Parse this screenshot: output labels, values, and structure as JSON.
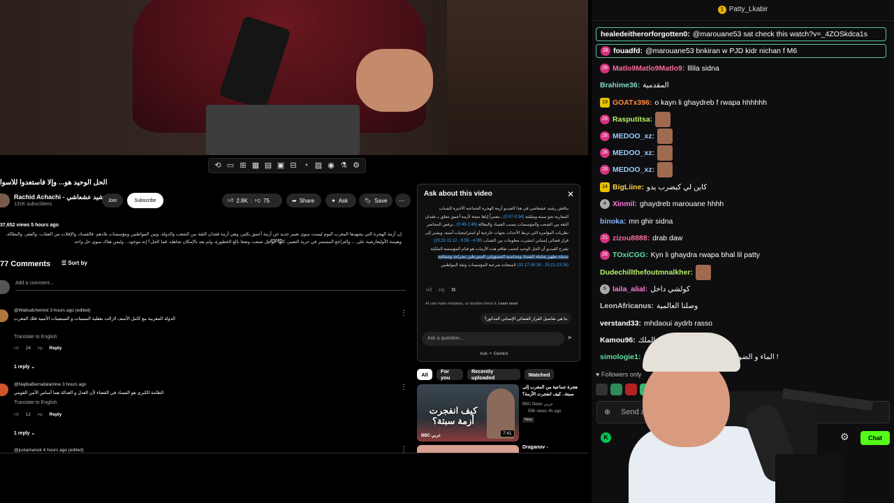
{
  "video": {
    "title": "الحل الوحيد هو... وإلا فاستعدوا للأسوأ"
  },
  "player_controls": [
    "⟲",
    "▭",
    "⊞",
    "▦",
    "▤",
    "▣",
    "⊟",
    "◔",
    "▨",
    "◉",
    "⚗",
    "⚙"
  ],
  "channel": {
    "name": "Rachid Achachi - رشيد عشعاشي",
    "subscribers": "131K subscribers",
    "join_label": "Join",
    "subscribe_label": "Subscribe"
  },
  "actions": {
    "likes": "2.8K",
    "dislikes": "75",
    "share": "Share",
    "ask": "Ask",
    "save": "Save"
  },
  "meta": {
    "views_time": "37,652 views  5 hours ago"
  },
  "description": {
    "text": "إن أزمة الهجرة التي يشهدها المغرب اليوم ليست سوى تعبير جديد عن أزمة أعمق بكثير، وهي أزمة فقدان الثقة بين الشعب والدولة، وبين المواطنين ومؤسسات بلادهم. فالفساد، والإفلات من العقاب، والفقر، والبطالة، وهيمنة الأوليغارشية على ... والتراجع المستمر في حرية التعبير، كلها عوامل صنعت وضعا بالغ الخطورة، ولم يعد بالإمكان تجاهله. فما الحل؟ إنه موجود... وليس هناك سوى حل واحد",
    "more": "...more"
  },
  "comments": {
    "count": "77 Comments",
    "sort": "Sort by",
    "add_placeholder": "Add a comment...",
    "items": [
      {
        "author": "@Wallsalchemist 3 hours ago (edited)",
        "text": "الدولة المغربية مع كامل الأسف لازالت بعقلية الستينات و السبعينات الأمنية فلك المغرب",
        "translate": "Translate to English",
        "likes": "24",
        "reply": "Reply",
        "replies": "1 reply"
      },
      {
        "author": "@NajibaBerradalamine 3 hours ago",
        "text": "الطامة الكبرى هو الفساد في القضاء لأن العدل و العدالة هما أساس الأمن القومي",
        "translate": "Translate to English",
        "likes": "12",
        "reply": "Reply",
        "replies": "1 reply"
      }
    ],
    "next_author": "@justamanok 4 hours ago (edited)"
  },
  "ask_panel": {
    "title": "Ask about this video",
    "body_1": "يناقش رشيد عشعاشي في هذا الفيديو أزمة الهجرة الجماعية الأخيرة للشباب المغاربة نحو سبتة ومليلية",
    "ts_1": "(0:34-0:07)",
    "body_2": "، معتبراً إياها نتيجة لأزمة أعمق تتعلق بـ فقدان الثقة بين الشعب والمؤسسات بسبب الفساد والبطالة",
    "ts_2": "(1:46-0:45)",
    "body_3": ". يرفض المحاضر نظريات المؤامرة التي تربط الأحداث بجهات خارجية أو استراتيجيات أمنية، ويشير إلى قرار قضائي إسباني انتشرت معلومات بين الشباب",
    "ts_3": "(4:39 - 6:59 ، 11:12-19:22)",
    "body_4": "يقترح الفيديو أن الحل الوحيد لتجنب تفاقم هذه الأزمات هو قيام المؤسسة الملكية",
    "highlight": "بحملة تطهير شاملة للفساد ومحاسبة المسؤولين المتورطين بصرامة وشفافية",
    "ts_4": "(23:26-25:21 ، 30:38-31:17)",
    "body_5": "لاستعادة شرعية المؤسسات وثقة المواطنين",
    "disclaimer": "AI can make mistakes, so double-check it.",
    "learn_more": "Learn more",
    "suggestion": "ما هي تفاصيل القرار القضائي الإسباني المذكور؟",
    "input_placeholder": "Ask a question...",
    "powered": "Ask ✧ Gemini"
  },
  "filters": [
    "All",
    "For you",
    "Recently uploaded",
    "Watched"
  ],
  "related": [
    {
      "title": "هجرة جماعية من المغرب إلى سبتة.. كيف انفجرت الأزمة؟",
      "thumb_text": "كيف انفجرت أزمة سبتة؟",
      "channel": "BBC News عربي",
      "meta": "59K views  4h ago",
      "badge": "New",
      "duration": "7:41",
      "logo": "BBC عربي"
    },
    {
      "title": "Draganov -"
    }
  ],
  "chat": {
    "pinned_user": "Patty_Lkabir",
    "pinned_count": "1",
    "messages": [
      {
        "user": "healedeitherorforgotten0:",
        "text": "@marouane53 sat check this watch?v=_4ZOSkdca1s",
        "color": "#ffffff",
        "badge": "",
        "highlight": true
      },
      {
        "user": "fouadfd:",
        "text": "@marouane53 bnkiran w PJD kidr nichan f M6",
        "color": "#ffffff",
        "badge": "28",
        "highlight": true
      },
      {
        "user": "Matlo9Matlo9Matlo9:",
        "text": "lllila sidna",
        "color": "#ff6b9d",
        "badge": "28"
      },
      {
        "user": "Brahime36:",
        "text": "المقدمية",
        "color": "#7fdbca",
        "badge": ""
      },
      {
        "user": "GOATx396:",
        "text": "o kayn li ghaydreb f rwapa hhhhhh",
        "color": "#ff8c42",
        "badge": "19"
      },
      {
        "user": "Rasputitsa:",
        "text": "",
        "color": "#b7f06a",
        "badge": "28",
        "emote": true
      },
      {
        "user": "MEDOO_xz:",
        "text": "",
        "color": "#9ecbff",
        "badge": "28",
        "emote": true
      },
      {
        "user": "MEDOO_xz:",
        "text": "",
        "color": "#9ecbff",
        "badge": "28",
        "emote": true
      },
      {
        "user": "MEDOO_xz:",
        "text": "",
        "color": "#9ecbff",
        "badge": "28",
        "emote": true
      },
      {
        "user": "BigLiine:",
        "text": "كاين لي كيضرب يدو",
        "color": "#ffd24a",
        "badge": "14"
      },
      {
        "user": "Xinmil:",
        "text": "ghaydreb marouane hhhh",
        "color": "#ff7ad9",
        "badge": "4"
      },
      {
        "user": "binoka:",
        "text": "mn ghir sidna",
        "color": "#8ab4ff",
        "badge": ""
      },
      {
        "user": "zizou8888:",
        "text": "drab daw",
        "color": "#ff6b9d",
        "badge": "21"
      },
      {
        "user": "TOxiCGG:",
        "text": "Kyn li ghaydra rwapa bhal lil patty",
        "color": "#5ee0a0",
        "badge": "28"
      },
      {
        "user": "Dudechillthefoutmnalkher:",
        "text": "",
        "color": "#b7f06a",
        "badge": "",
        "emote": true
      },
      {
        "user": "laila_alial:",
        "text": "كولشي داخل",
        "color": "#ff7ad9",
        "badge": "6"
      },
      {
        "user": "LeonAfricanus:",
        "text": "وصلنا العالمية",
        "color": "#cfcfcf",
        "badge": ""
      },
      {
        "user": "verstand33:",
        "text": "mhdaoui aydrb rasso",
        "color": "#ffffff",
        "badge": ""
      },
      {
        "user": "Kamou96:",
        "text": "الله الوطن الملك",
        "color": "#ffffff",
        "badge": ""
      },
      {
        "user": "simologie1:",
        "text": "الماء و الضوء ديال ... اضغطو عليهم بهادشي !",
        "color": "#5ee0a0",
        "badge": ""
      }
    ],
    "followers_only": "Followers only",
    "input_placeholder": "Send a message",
    "chat_button": "Chat"
  },
  "colors": {
    "accent_green": "#53fc18",
    "yt_blue": "#3ea6ff"
  }
}
